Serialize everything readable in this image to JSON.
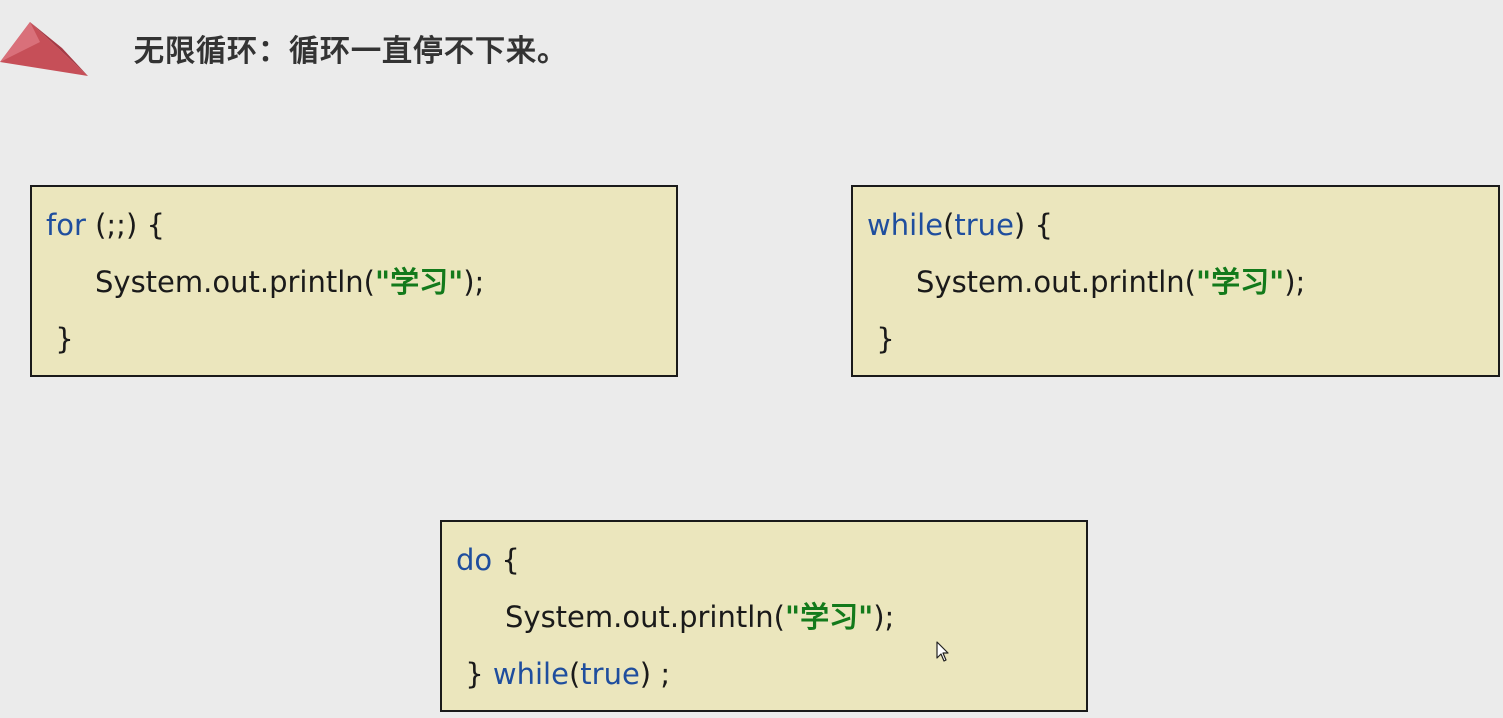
{
  "title": "无限循环：循环一直停不下来。",
  "colors": {
    "background": "#ebebeb",
    "code_box_fill": "#ebe6bd",
    "keyword": "#1f4e9e",
    "string": "#137a1b",
    "logo": "#c9505a"
  },
  "icons": {
    "logo": "pyramid-logo-icon",
    "cursor": "mouse-pointer-icon"
  },
  "for_box": {
    "kw_for": "for",
    "header_rest": " (;;) {",
    "body_prefix": "System.out.println(",
    "body_string": "\"学习\"",
    "body_suffix": ");",
    "closing": " }"
  },
  "while_box": {
    "kw_while": "while",
    "paren_open": "(",
    "kw_true": "true",
    "header_rest": ") {",
    "body_prefix": "System.out.println(",
    "body_string": "\"学习\"",
    "body_suffix": ");",
    "closing": " }"
  },
  "do_box": {
    "kw_do": "do",
    "header_rest": " {",
    "body_prefix": "System.out.println(",
    "body_string": "\"学习\"",
    "body_suffix": ");",
    "closing_brace": " } ",
    "kw_while": "while",
    "paren_open": "(",
    "kw_true": "true",
    "closing_rest": ") ;"
  }
}
